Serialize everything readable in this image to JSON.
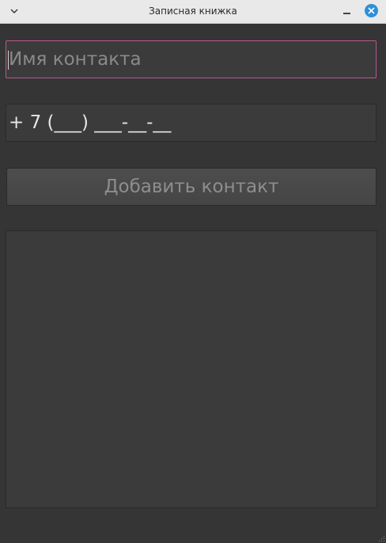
{
  "window": {
    "title": "Записная книжка"
  },
  "form": {
    "name_placeholder": "Имя контакта",
    "name_value": "",
    "phone_mask": "+ 7 (___) ___-__-__",
    "add_button_label": "Добавить контакт"
  },
  "contacts": [],
  "icons": {
    "menu": "chevron-down-icon",
    "minimize": "minimize-icon",
    "close": "close-icon",
    "resize": "resize-grip-icon"
  },
  "colors": {
    "background": "#353535",
    "field_background": "#3b3b3b",
    "focus_border": "#b45a8c",
    "close_button": "#2d8fd9"
  }
}
